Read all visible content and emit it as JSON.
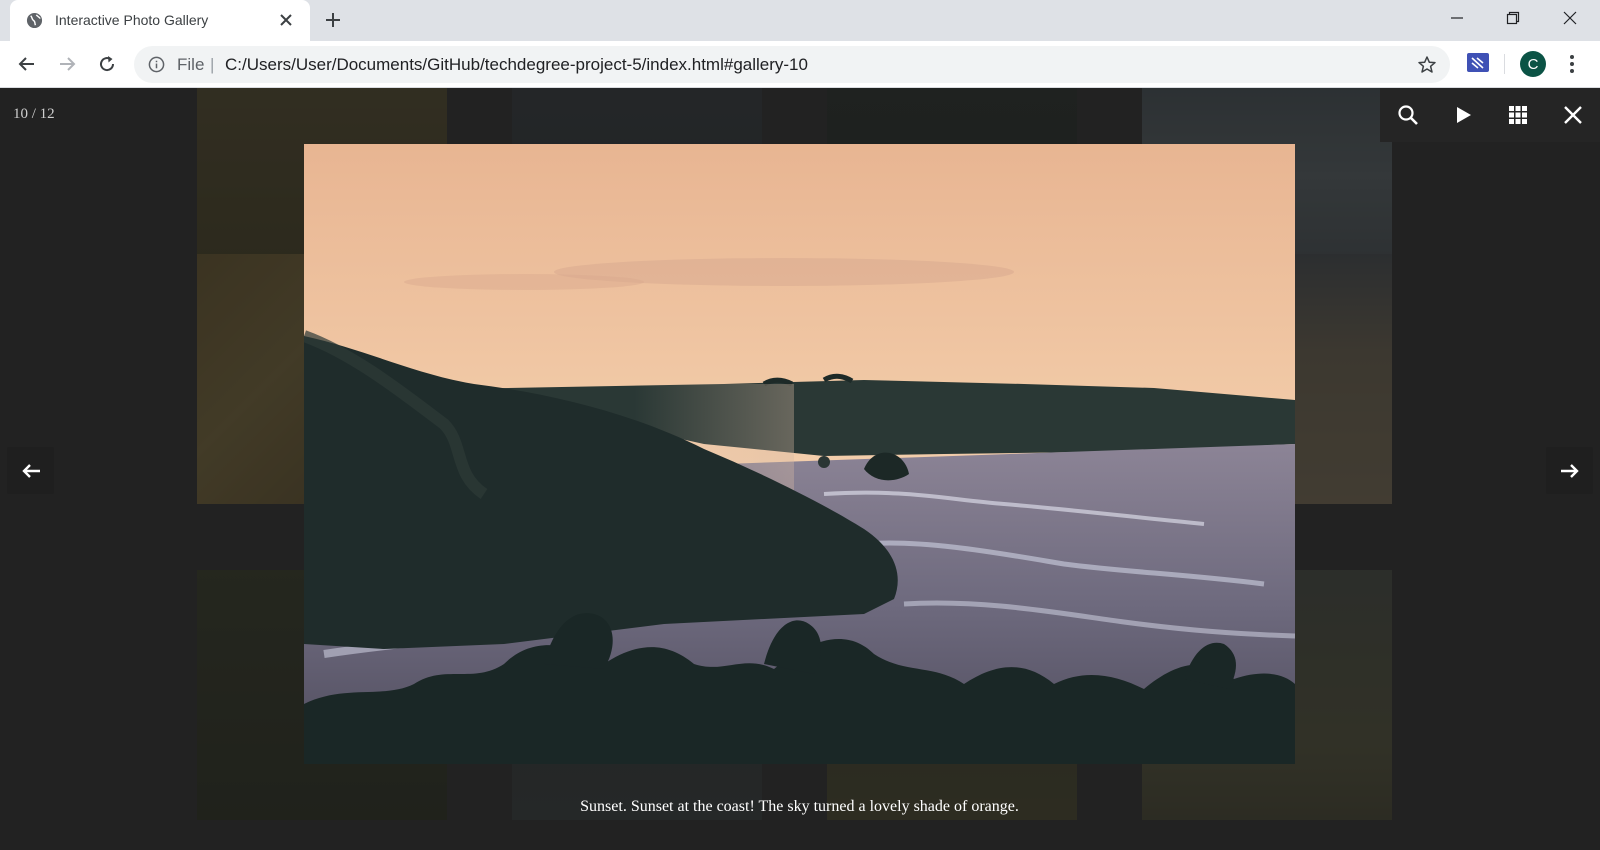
{
  "browser": {
    "tab_title": "Interactive Photo Gallery",
    "tab_icon": "globe-icon",
    "address_scheme": "File",
    "address_separator": "|",
    "url": "C:/Users/User/Documents/GitHub/techdegree-project-5/index.html#gallery-10",
    "profile_initial": "C",
    "profile_color": "#0b5345"
  },
  "lightbox": {
    "counter": "10 / 12",
    "caption": "Sunset. Sunset at the coast! The sky turned a lovely shade of orange.",
    "toolbar_icons": [
      "zoom-icon",
      "play-icon",
      "grid-icon",
      "close-icon"
    ],
    "prev_icon": "arrow-left-icon",
    "next_icon": "arrow-right-icon"
  },
  "colors": {
    "page_background": "#333333",
    "lightbox_toolbar": "#252525",
    "caption_text": "#ffffff"
  }
}
